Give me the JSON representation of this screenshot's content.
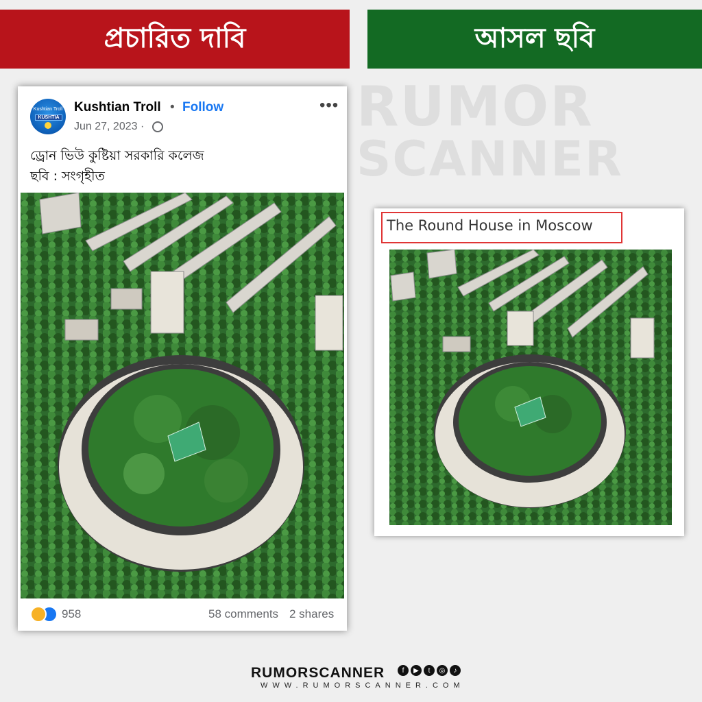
{
  "banners": {
    "left": "প্রচারিত দাবি",
    "right": "আসল ছবি"
  },
  "watermark": {
    "line1": "RUMOR",
    "line2": "SCANNER"
  },
  "post": {
    "avatar_text": "Kushtian Troll",
    "avatar_badge": "KUSHTIA",
    "page_name": "Kushtian Troll",
    "separator": "•",
    "follow_label": "Follow",
    "date": "Jun 27, 2023 ·",
    "menu": "•••",
    "caption_line1": "ড্রোন ভিউ কুষ্টিয়া সরকারি কলেজ",
    "caption_line2": "ছবি : সংগৃহীত",
    "reaction_count": "958",
    "comments": "58 comments",
    "shares": "2 shares",
    "icons": [
      "globe-icon",
      "more-options-icon",
      "haha-reaction-icon",
      "like-reaction-icon"
    ]
  },
  "source": {
    "title": "The Round House in Moscow"
  },
  "footer": {
    "brand": "RUMORSCANNER",
    "url": "WWW.RUMORSCANNER.COM",
    "social_icons": [
      "facebook-icon",
      "youtube-icon",
      "twitter-icon",
      "instagram-icon",
      "tiktok-icon"
    ]
  },
  "colors": {
    "red": "#b8141b",
    "green": "#136a23",
    "facebook_blue": "#1877f2"
  }
}
